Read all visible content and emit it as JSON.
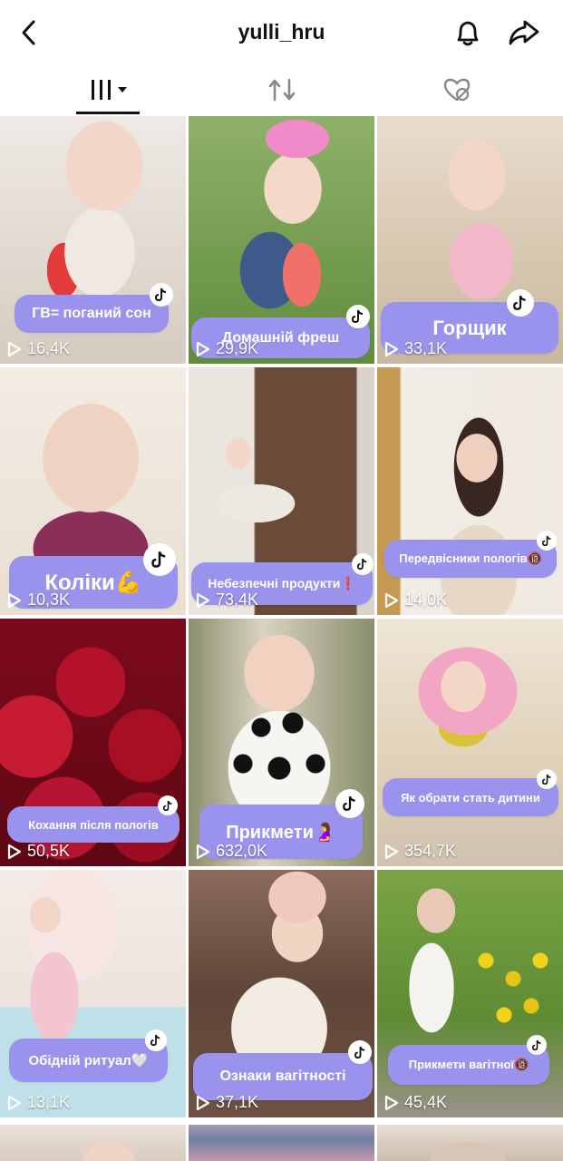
{
  "header": {
    "title": "yulli_hru",
    "back_icon": "chevron-left-icon",
    "bell_icon": "bell-icon",
    "share_icon": "share-arrow-icon"
  },
  "tabs": [
    {
      "name": "videos-grid-icon",
      "active": true
    },
    {
      "name": "repost-icon",
      "active": false
    },
    {
      "name": "liked-hidden-icon",
      "active": false
    }
  ],
  "videos": [
    {
      "caption": "ГВ= поганий сон",
      "views": "16,4K"
    },
    {
      "caption": "Домашній фреш",
      "views": "29,9K"
    },
    {
      "caption": "Горщик",
      "views": "33,1K"
    },
    {
      "caption": "Коліки💪",
      "views": "10,3K"
    },
    {
      "caption": "Небезпечні продукти❗",
      "views": "73,4K"
    },
    {
      "caption": "Передвісники пологів🔞",
      "views": "14,0K"
    },
    {
      "caption": "Кохання після пологів",
      "views": "50,5K"
    },
    {
      "caption": "Прикмети🤰",
      "views": "632,0K"
    },
    {
      "caption": "Як обрати стать дитини",
      "views": "354,7K"
    },
    {
      "caption": "Обідній ритуал🤍",
      "views": "13,1K"
    },
    {
      "caption": "Ознаки вагітності",
      "views": "37,1K"
    },
    {
      "caption": "Прикмети вагітної🔞",
      "views": "45,4K"
    }
  ],
  "colors": {
    "caption_bg": "#9a93ee",
    "text": "#111111"
  }
}
